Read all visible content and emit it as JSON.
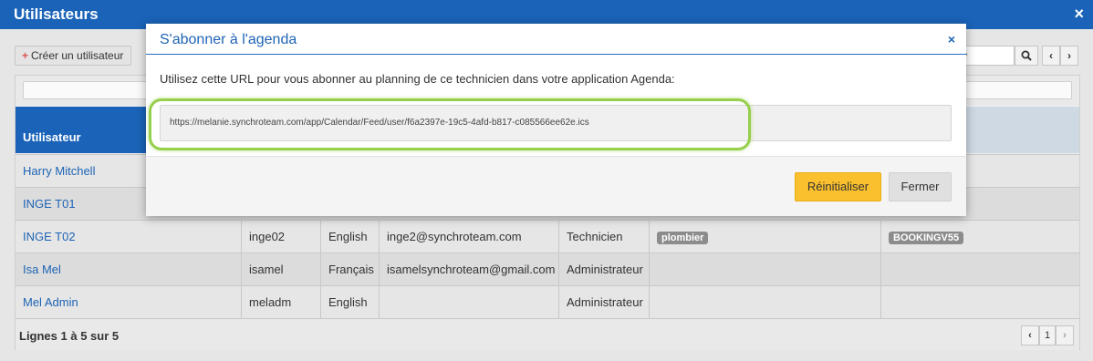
{
  "window": {
    "title": "Utilisateurs",
    "close_icon": "×"
  },
  "toolbar": {
    "create_label": "Créer un utilisateur",
    "create_icon": "+",
    "search_placeholder": "é",
    "search_icon": "search-icon",
    "prev_icon": "‹",
    "next_icon": "›"
  },
  "table": {
    "header": "Utilisateur",
    "rows": [
      {
        "name": "Harry Mitchell",
        "login": "",
        "language": "",
        "email": "",
        "role": "",
        "skill": "",
        "group": ""
      },
      {
        "name": "INGE T01",
        "login": "",
        "language": "",
        "email": "",
        "role": "",
        "skill": "",
        "group": ""
      },
      {
        "name": "INGE T02",
        "login": "inge02",
        "language": "English",
        "email": "inge2@synchroteam.com",
        "role": "Technicien",
        "skill": "plombier",
        "group": "BOOKINGV55"
      },
      {
        "name": "Isa Mel",
        "login": "isamel",
        "language": "Français",
        "email": "isamelsynchroteam@gmail.com",
        "role": "Administrateur",
        "skill": "",
        "group": ""
      },
      {
        "name": "Mel Admin",
        "login": "meladm",
        "language": "English",
        "email": "",
        "role": "Administrateur",
        "skill": "",
        "group": ""
      }
    ],
    "footer": "Lignes 1 à 5 sur 5",
    "page": "1",
    "page_prev": "‹",
    "page_next": "›"
  },
  "modal": {
    "title": "S'abonner à l'agenda",
    "close_icon": "×",
    "instructions": "Utilisez cette URL pour vous abonner au planning de ce technicien dans votre application Agenda:",
    "url": "https://melanie.synchroteam.com/app/Calendar/Feed/user/f6a2397e-19c5-4afd-b817-c085566ee62e.ics",
    "reset_label": "Réinitialiser",
    "close_label": "Fermer"
  },
  "colors": {
    "titlebar": "#1a63b8",
    "link": "#1e64b4",
    "highlight": "#96cf4c",
    "reset_button": "#fbc02d"
  }
}
